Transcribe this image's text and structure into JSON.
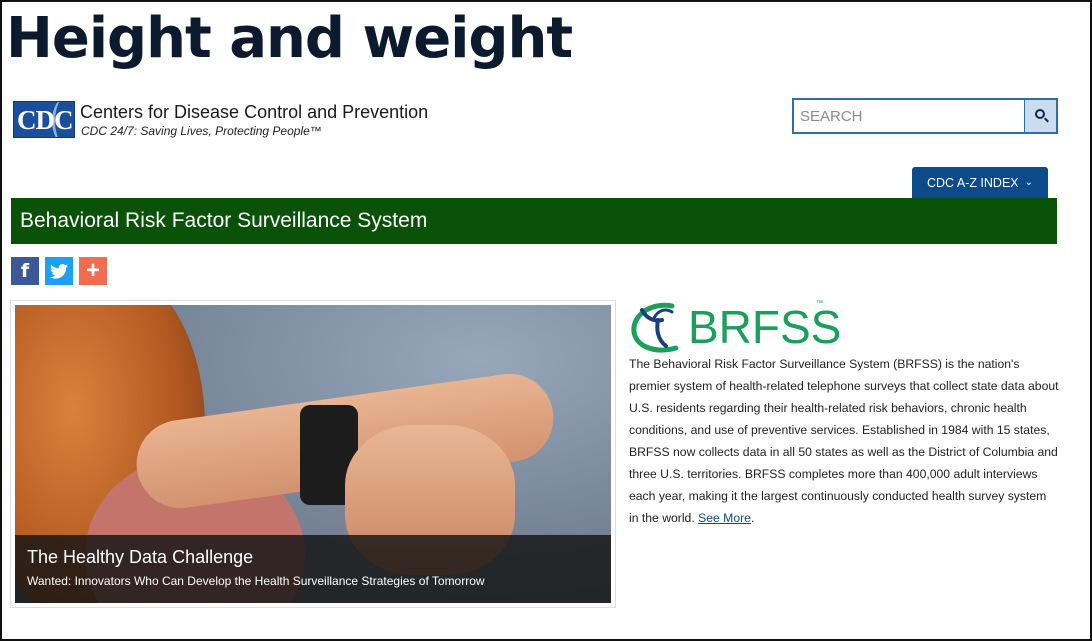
{
  "page": {
    "title": "Height and weight"
  },
  "header": {
    "logo_text": "CDC",
    "org_name": "Centers for Disease Control and Prevention",
    "tagline": "CDC 24/7: Saving Lives, Protecting People™",
    "search": {
      "placeholder": "SEARCH",
      "value": "",
      "icon": "search-icon"
    },
    "az_index_label": "CDC A-Z INDEX"
  },
  "banner": {
    "title": "Behavioral Risk Factor Surveillance System",
    "color": "#0b5209"
  },
  "social": [
    {
      "name": "facebook",
      "glyph": "f",
      "icon": "facebook-icon"
    },
    {
      "name": "twitter",
      "glyph": "",
      "icon": "twitter-icon"
    },
    {
      "name": "more",
      "glyph": "+",
      "icon": "plus-icon"
    }
  ],
  "hero": {
    "title": "The Healthy Data Challenge",
    "subtitle": "Wanted: Innovators Who Can Develop the Health Surveillance Strategies of Tomorrow"
  },
  "brfss": {
    "logo_text": "BRFSS",
    "tm": "™",
    "description": "The Behavioral Risk Factor Surveillance System (BRFSS) is the nation's premier system of health-related telephone surveys that collect state data about U.S. residents regarding their health-related risk behaviors, chronic health conditions, and use of preventive services. Established in 1984 with 15 states, BRFSS now collects data in all 50 states as well as the District of Columbia and three U.S. territories. BRFSS completes more than 400,000 adult interviews each year, making it the largest continuously conducted health survey system in the world.",
    "see_more": "See More",
    "trailing": "."
  },
  "colors": {
    "accent": "#0d4a8a",
    "brfss_green": "#1aa05a",
    "banner_green": "#0b5209"
  }
}
